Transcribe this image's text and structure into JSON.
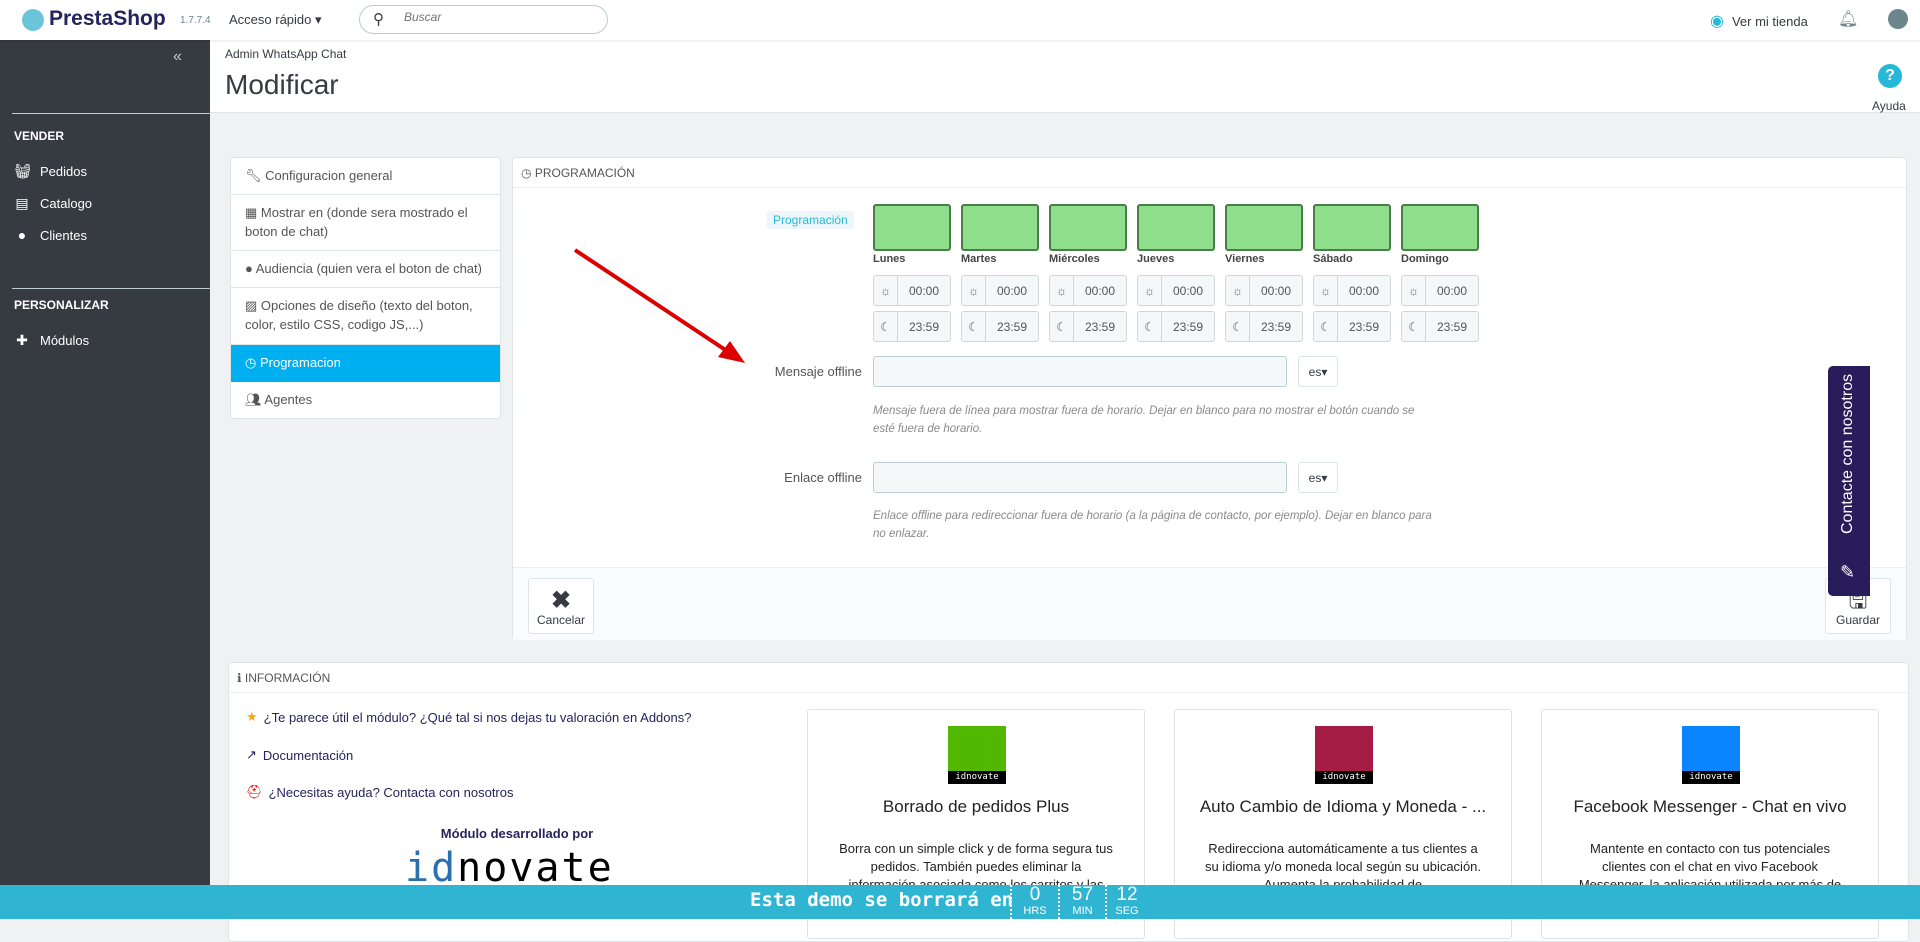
{
  "topbar": {
    "brand": "PrestaShop",
    "version": "1.7.7.4",
    "quick_access": "Acceso rápido",
    "search_placeholder": "Buscar",
    "view_store": "Ver mi tienda"
  },
  "sidebar": {
    "collapse": "«",
    "sections": [
      {
        "title": "VENDER",
        "items": [
          {
            "label": "Pedidos",
            "icon": "basket-icon"
          },
          {
            "label": "Catalogo",
            "icon": "store-icon"
          },
          {
            "label": "Clientes",
            "icon": "user-circle-icon"
          }
        ]
      },
      {
        "title": "PERSONALIZAR",
        "items": [
          {
            "label": "Módulos",
            "icon": "puzzle-icon"
          }
        ]
      }
    ]
  },
  "page": {
    "breadcrumb": "Admin WhatsApp Chat",
    "title": "Modificar",
    "help": "Ayuda"
  },
  "menu": [
    {
      "label": "Configuracion general"
    },
    {
      "label": "Mostrar en (donde sera mostrado el boton de chat)"
    },
    {
      "label": "Audiencia (quien vera el boton de chat)"
    },
    {
      "label": "Opciones de diseño (texto del boton, color, estilo CSS, codigo JS,...)"
    },
    {
      "label": "Programacion",
      "active": true
    },
    {
      "label": "Agentes"
    }
  ],
  "schedule": {
    "heading": "PROGRAMACIÓN",
    "tag": "Programación",
    "color_active": "#8ede8c",
    "days": [
      {
        "name": "Lunes",
        "start": "00:00",
        "end": "23:59"
      },
      {
        "name": "Martes",
        "start": "00:00",
        "end": "23:59"
      },
      {
        "name": "Miércoles",
        "start": "00:00",
        "end": "23:59"
      },
      {
        "name": "Jueves",
        "start": "00:00",
        "end": "23:59"
      },
      {
        "name": "Viernes",
        "start": "00:00",
        "end": "23:59"
      },
      {
        "name": "Sábado",
        "start": "00:00",
        "end": "23:59"
      },
      {
        "name": "Domingo",
        "start": "00:00",
        "end": "23:59"
      }
    ],
    "offline_message": {
      "label": "Mensaje offline",
      "value": "",
      "lang": "es",
      "help": "Mensaje fuera de línea para mostrar fuera de horario. Dejar en blanco para no mostrar el botón cuando se esté fuera de horario."
    },
    "offline_link": {
      "label": "Enlace offline",
      "value": "",
      "lang": "es",
      "help": "Enlace offline para redireccionar fuera de horario (a la página de contacto, por ejemplo). Dejar en blanco para no enlazar."
    },
    "cancel": "Cancelar",
    "save": "Guardar"
  },
  "contact_tab": "Contacte con nosotros",
  "info": {
    "heading": "INFORMACIÓN",
    "links": [
      "¿Te parece útil el módulo? ¿Qué tal si nos dejas tu valoración en Addons?",
      "Documentación",
      "¿Necesitas ayuda? Contacta con nosotros"
    ],
    "developed_by": "Módulo desarrollado por",
    "logo": "idnovate",
    "cards": [
      {
        "title": "Borrado de pedidos Plus",
        "desc": "Borra con un simple click y de forma segura tus pedidos. También puedes eliminar la información asociada como los carritos y las",
        "color": "#52b700",
        "badge": "idnovate"
      },
      {
        "title": "Auto Cambio de Idioma y Moneda - ...",
        "desc": "Redirecciona automáticamente a tus clientes a su idioma y/o moneda local según su ubicación. Aumenta la probabilidad de",
        "color": "#a51d45",
        "badge": "idnovate"
      },
      {
        "title": "Facebook Messenger - Chat en vivo",
        "desc": "Mantente en contacto con tus potenciales clientes con el chat en vivo Facebook Messenger, la aplicación utilizada por más de",
        "color": "#0a84ff",
        "badge": "idnovate"
      }
    ]
  },
  "demo_bar": {
    "text": "Esta demo se borrará en",
    "hours": "0",
    "hours_label": "HRS",
    "minutes": "57",
    "minutes_label": "MIN",
    "seconds": "12",
    "seconds_label": "SEG"
  }
}
